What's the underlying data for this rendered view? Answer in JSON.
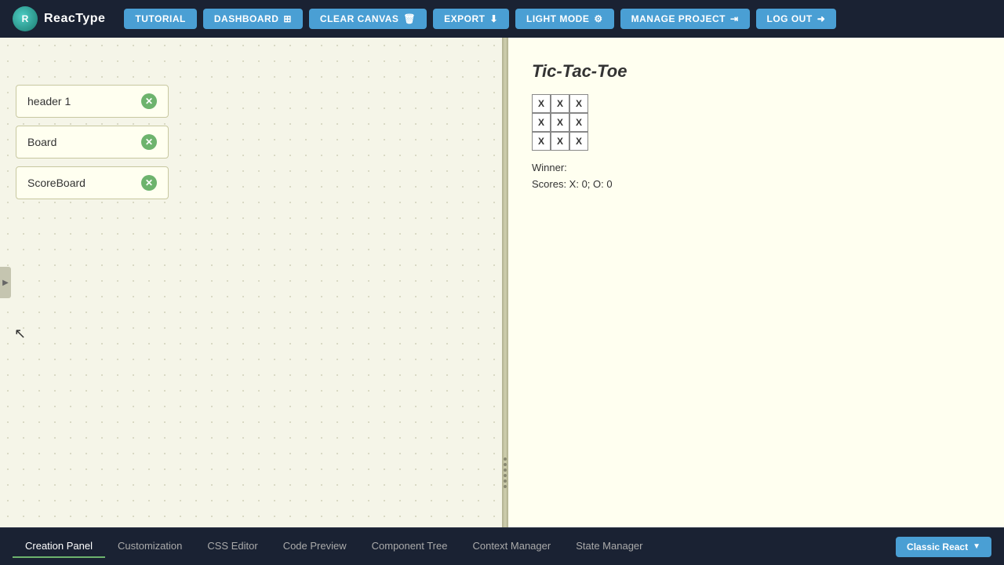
{
  "app": {
    "name": "ReacType"
  },
  "header": {
    "logo_text": "ReacType",
    "buttons": [
      {
        "id": "tutorial",
        "label": "TUTORIAL",
        "icon": null
      },
      {
        "id": "dashboard",
        "label": "DASHBOARD",
        "icon": "grid"
      },
      {
        "id": "clear-canvas",
        "label": "CLEAR CANVAS",
        "icon": "trash"
      },
      {
        "id": "export",
        "label": "EXPORT",
        "icon": "download"
      },
      {
        "id": "light-mode",
        "label": "LIGHT MODE",
        "icon": "settings"
      },
      {
        "id": "manage-project",
        "label": "MANAGE PROJECT",
        "icon": "filter"
      },
      {
        "id": "log-out",
        "label": "LOG OUT",
        "icon": "arrow-right"
      }
    ]
  },
  "left_panel": {
    "components": [
      {
        "id": "header1",
        "label": "header 1"
      },
      {
        "id": "board",
        "label": "Board"
      },
      {
        "id": "scoreboard",
        "label": "ScoreBoard"
      }
    ]
  },
  "preview": {
    "title": "Tic-Tac-Toe",
    "board": [
      "X",
      "X",
      "X",
      "X",
      "X",
      "X",
      "X",
      "X",
      "X"
    ],
    "winner_label": "Winner:",
    "winner_value": "",
    "scores_label": "Scores: X: 0; O: 0"
  },
  "bottom_tabs": [
    {
      "id": "creation-panel",
      "label": "Creation Panel",
      "active": true
    },
    {
      "id": "customization",
      "label": "Customization",
      "active": false
    },
    {
      "id": "css-editor",
      "label": "CSS Editor",
      "active": false
    },
    {
      "id": "code-preview",
      "label": "Code Preview",
      "active": false
    },
    {
      "id": "component-tree",
      "label": "Component Tree",
      "active": false
    },
    {
      "id": "context-manager",
      "label": "Context Manager",
      "active": false
    },
    {
      "id": "state-manager",
      "label": "State Manager",
      "active": false
    }
  ],
  "classic_react_btn": "Classic React"
}
